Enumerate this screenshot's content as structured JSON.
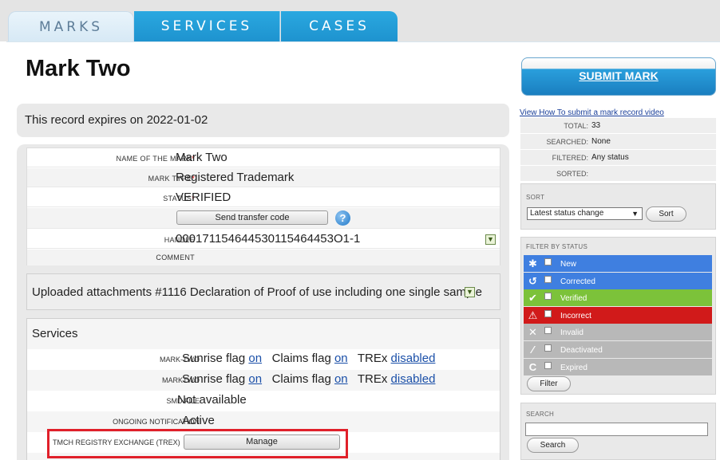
{
  "tabs": [
    {
      "label": "MARKS"
    },
    {
      "label": "SERVICES"
    },
    {
      "label": "CASES"
    }
  ],
  "page_title": "Mark Two",
  "expiry_text": "This record expires on 2022-01-02",
  "details": {
    "name_label": "Name of the mark",
    "name_value": "Mark Two",
    "type_label": "Mark type",
    "type_value": "Registered Trademark",
    "status_label": "Status",
    "status_value": "VERIFIED",
    "transfer_button": "Send transfer code",
    "help_icon": "?",
    "handle_label": "Handle",
    "handle_value": "000171154644530115464453O1-1",
    "comment_label": "Comment",
    "required_mark": "*"
  },
  "attachment_text": "Uploaded attachments #1116 Declaration of Proof of use including one single sample",
  "services": {
    "title": "Services",
    "rows": [
      {
        "label": "Mark-Two",
        "sunrise": "Sunrise flag",
        "sunrise_link": "on",
        "claims": "Claims flag",
        "claims_link": "on",
        "trex": "TREx",
        "trex_link": "disabled"
      },
      {
        "label": "Marktwo",
        "sunrise": "Sunrise flag",
        "sunrise_link": "on",
        "claims": "Claims flag",
        "claims_link": "on",
        "trex": "TREx",
        "trex_link": "disabled"
      }
    ],
    "smd_label": "SMD file",
    "smd_value": "Not available",
    "notification_label": "Ongoing notification",
    "notification_value": "Active",
    "trex_label": "TMCH Registry Exchange (TREX)",
    "manage_button": "Manage"
  },
  "sidebar": {
    "submit_button": "SUBMIT MARK",
    "video_link": "View How To submit a mark record video",
    "stats": [
      {
        "key": "TOTAL:",
        "value": "33"
      },
      {
        "key": "SEARCHED:",
        "value": "None"
      },
      {
        "key": "FILTERED:",
        "value": "Any status"
      },
      {
        "key": "SORTED:",
        "value": ""
      }
    ],
    "sort_title": "SORT",
    "sort_selected": "Latest status change",
    "sort_button": "Sort",
    "filter_title": "FILTER BY STATUS",
    "filters": [
      {
        "label": "New",
        "color": "#3f7fe0",
        "icon": "gear-icon",
        "glyph": "✱"
      },
      {
        "label": "Corrected",
        "color": "#3f7fe0",
        "icon": "undo-icon",
        "glyph": "↺"
      },
      {
        "label": "Verified",
        "color": "#7cc23a",
        "icon": "check-icon",
        "glyph": "✔"
      },
      {
        "label": "Incorrect",
        "color": "#d11a1a",
        "icon": "warning-icon",
        "glyph": "⚠"
      },
      {
        "label": "Invalid",
        "color": "#b8b8b8",
        "icon": "x-icon",
        "glyph": "✕"
      },
      {
        "label": "Deactivated",
        "color": "#b8b8b8",
        "icon": "slash-icon",
        "glyph": "∕"
      },
      {
        "label": "Expired",
        "color": "#b8b8b8",
        "icon": "expired-icon",
        "glyph": "C"
      }
    ],
    "filter_button": "Filter",
    "search_title": "SEARCH",
    "search_value": "",
    "search_button": "Search"
  }
}
